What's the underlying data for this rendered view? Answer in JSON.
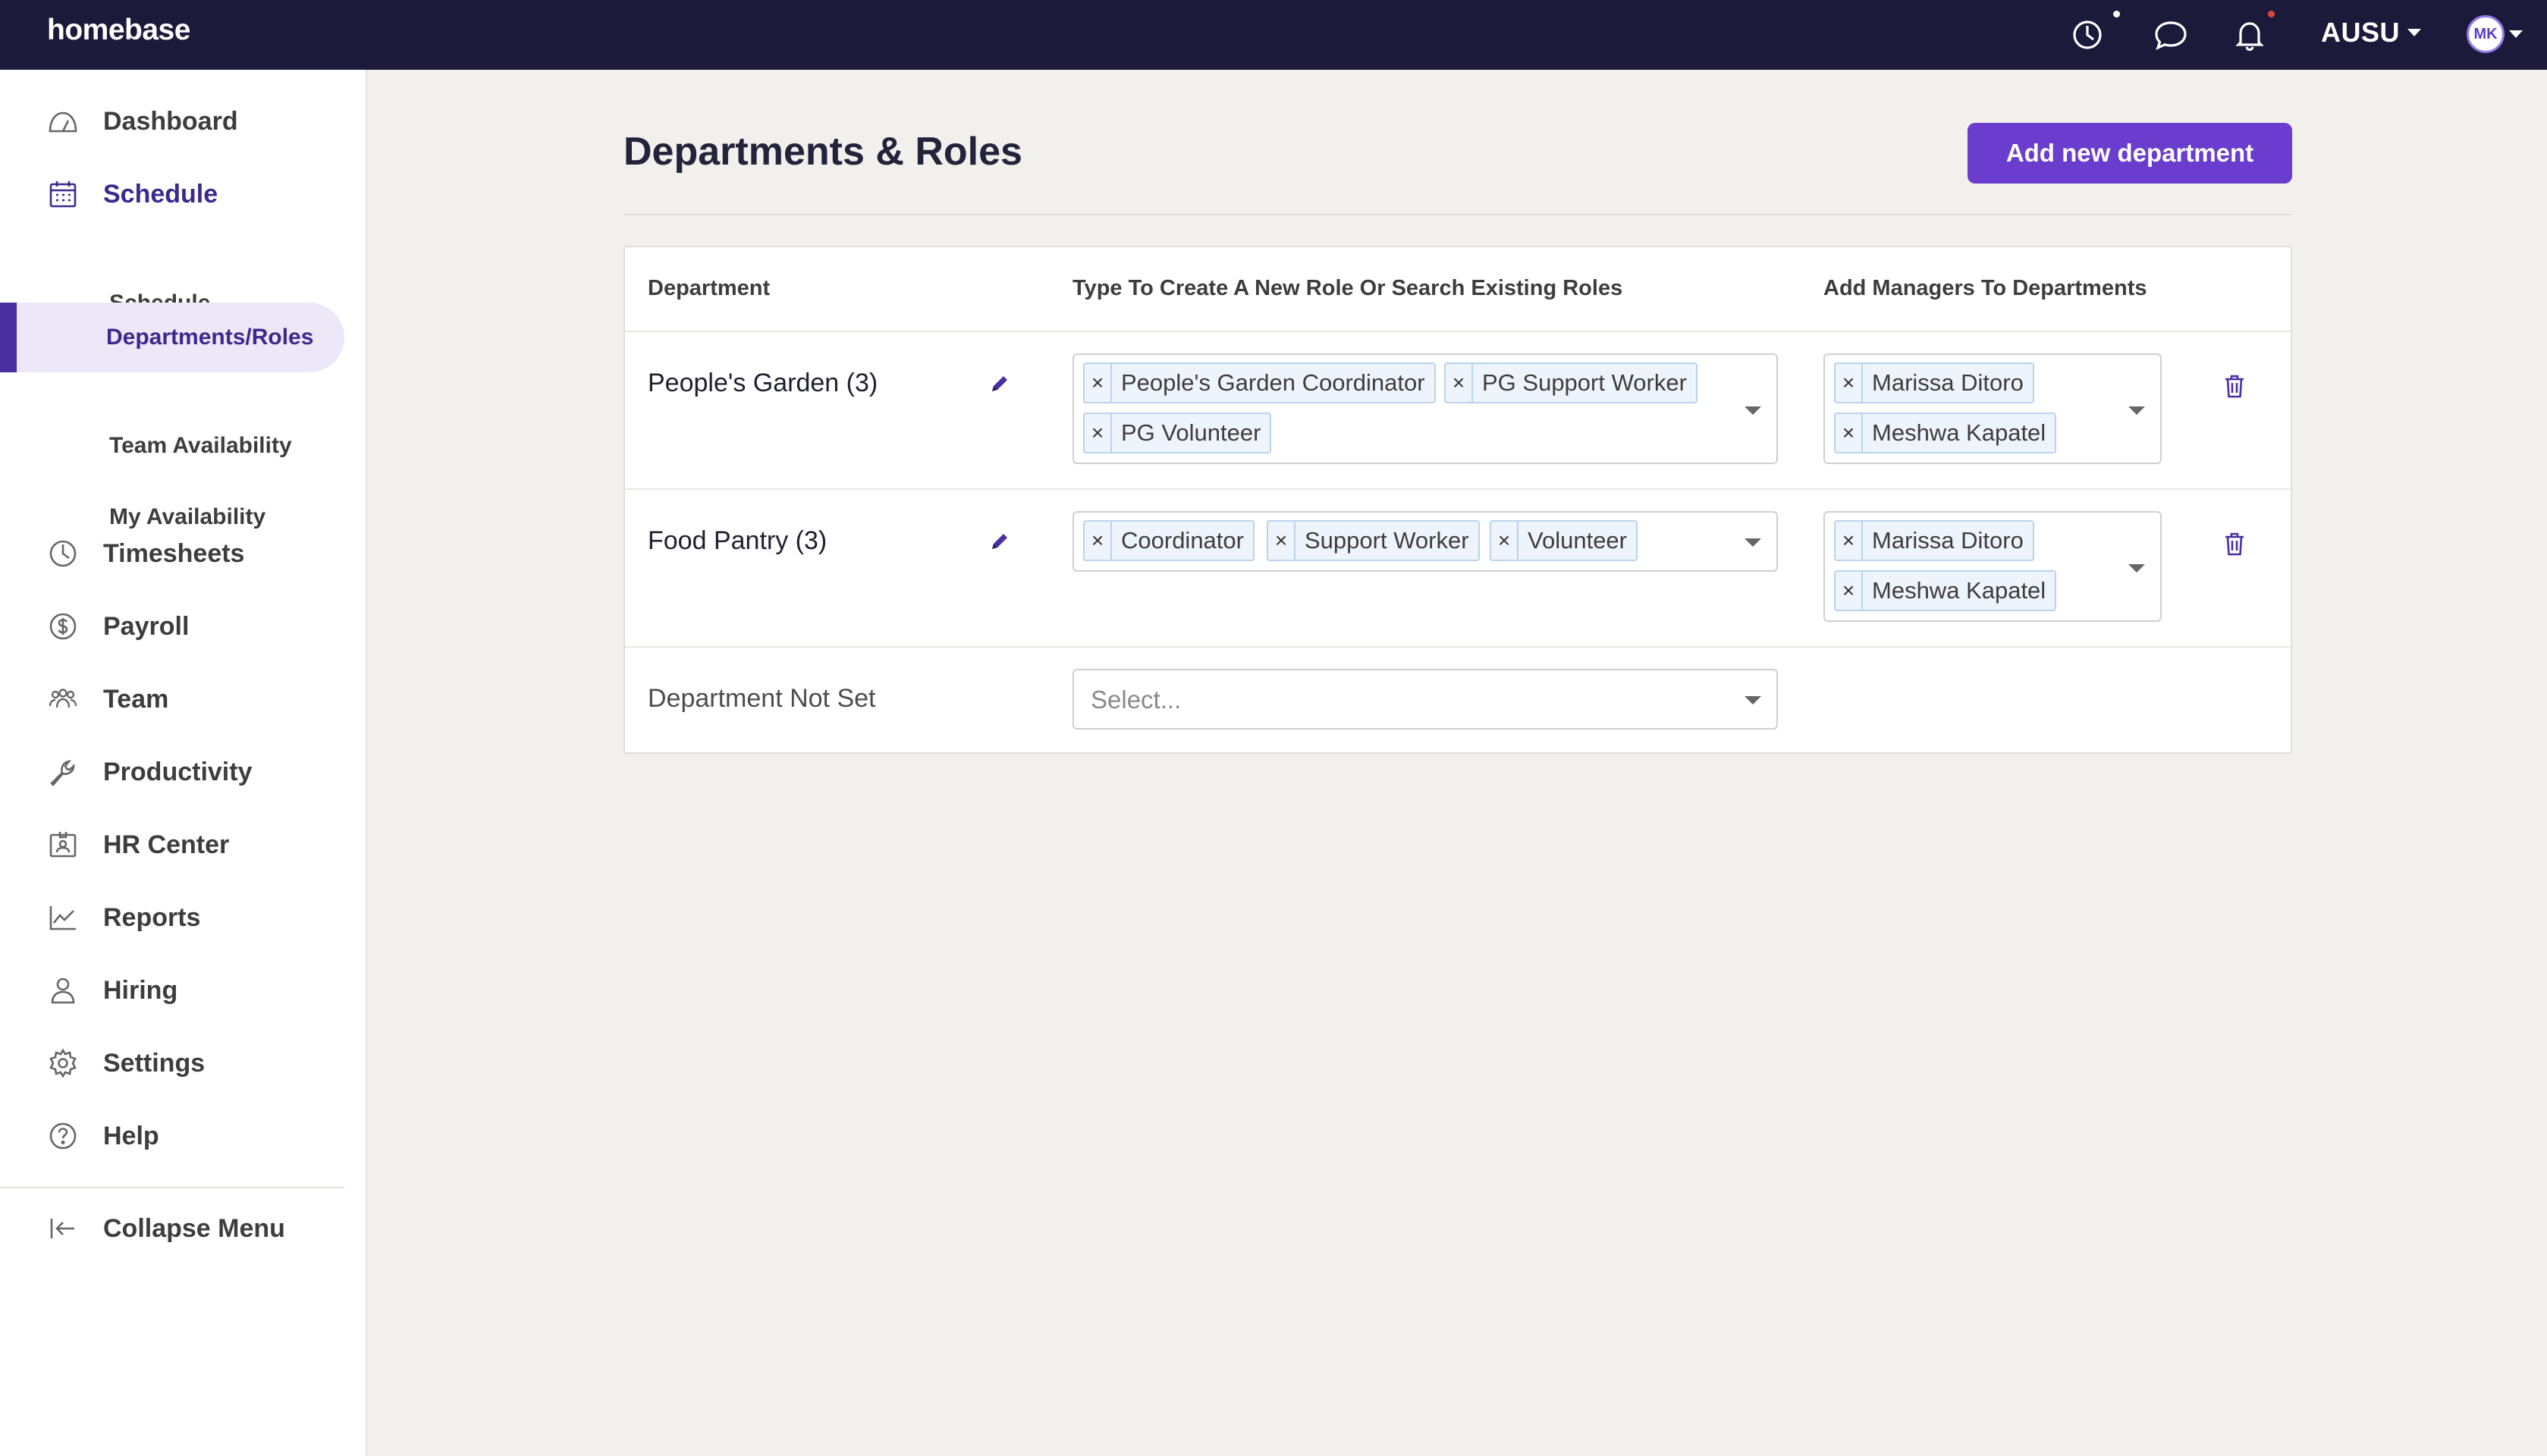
{
  "app": {
    "logo": "homebase"
  },
  "topbar": {
    "org_name": "AUSU",
    "avatar_initials": "MK",
    "icons": [
      "timeclock-icon",
      "chat-icon",
      "bell-icon"
    ],
    "colors": {
      "background": "#1b1a3a",
      "notification_dot": "#e0473c"
    }
  },
  "sidebar": {
    "items": [
      {
        "label": "Dashboard",
        "icon": "dashboard-icon"
      },
      {
        "label": "Schedule",
        "icon": "calendar-icon",
        "active": true
      },
      {
        "label": "Timesheets",
        "icon": "clock-icon"
      },
      {
        "label": "Payroll",
        "icon": "dollar-icon"
      },
      {
        "label": "Team",
        "icon": "team-icon"
      },
      {
        "label": "Productivity",
        "icon": "wrench-icon"
      },
      {
        "label": "HR Center",
        "icon": "id-badge-icon"
      },
      {
        "label": "Reports",
        "icon": "chart-icon"
      },
      {
        "label": "Hiring",
        "icon": "person-icon"
      },
      {
        "label": "Settings",
        "icon": "gear-icon"
      },
      {
        "label": "Help",
        "icon": "help-icon"
      }
    ],
    "schedule_subitems": [
      {
        "label": "Schedule"
      },
      {
        "label": "Departments/Roles",
        "active": true
      },
      {
        "label": "Team Availability"
      },
      {
        "label": "My Availability"
      }
    ],
    "collapse_label": "Collapse Menu"
  },
  "main": {
    "title": "Departments & Roles",
    "add_button": "Add new department",
    "accent_color": "#6b3dce",
    "table": {
      "headers": [
        "Department",
        "Type To Create A New Role Or Search Existing Roles",
        "Add Managers To Departments"
      ],
      "rows": [
        {
          "department": "People's Garden (3)",
          "roles": [
            "People's Garden Coordinator",
            "PG Support Worker",
            "PG Volunteer"
          ],
          "managers": [
            "Marissa Ditoro",
            "Meshwa Kapatel"
          ]
        },
        {
          "department": "Food Pantry (3)",
          "roles": [
            "Coordinator",
            "Support Worker",
            "Volunteer"
          ],
          "managers": [
            "Marissa Ditoro",
            "Meshwa Kapatel"
          ]
        },
        {
          "department": "Department Not Set",
          "roles_placeholder": "Select..."
        }
      ]
    }
  }
}
